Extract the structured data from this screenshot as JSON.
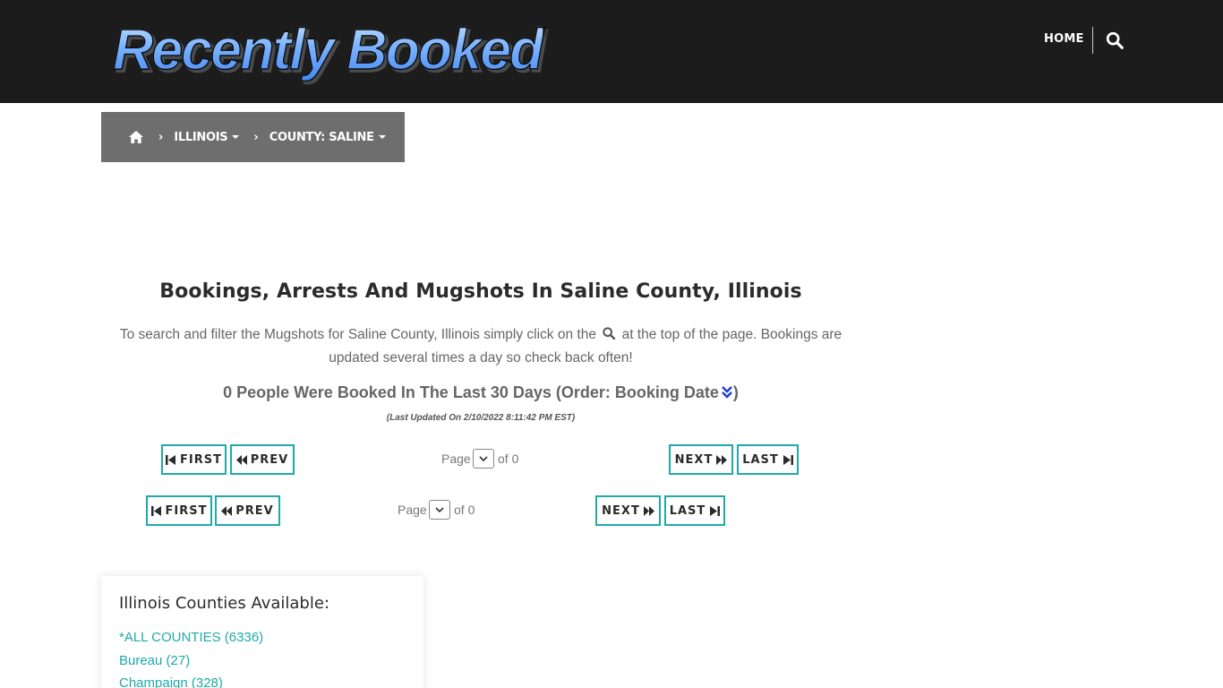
{
  "header": {
    "logo_text": "Recently Booked",
    "nav_home": "HOME",
    "search_icon": "search-icon"
  },
  "breadcrumb": {
    "home_icon": "home-icon",
    "items": [
      {
        "label": "ILLINOIS"
      },
      {
        "label": "COUNTY: SALINE"
      }
    ]
  },
  "main": {
    "headline": "Bookings, Arrests And Mugshots In Saline County, Illinois",
    "intro_before": "To search and filter the Mugshots for Saline County, Illinois simply click on the",
    "intro_after": "at the top of the page. Bookings are updated several times a day so check back often!",
    "count_text": "0 People Were Booked In The Last 30 Days (Order: Booking Date",
    "count_close": ")",
    "last_updated": "(Last Updated On 2/10/2022 8:11:42 PM EST)"
  },
  "pager": {
    "first": "FIRST",
    "prev": "PREV",
    "next": "NEXT",
    "last": "LAST",
    "page_label": "Page",
    "of_label": "of 0"
  },
  "counties": {
    "title": "Illinois Counties Available:",
    "items": [
      {
        "label": "*ALL COUNTIES (6336)"
      },
      {
        "label": "Bureau (27)"
      },
      {
        "label": "Champaign (328)"
      }
    ]
  },
  "colors": {
    "header_bg": "#1c1c1c",
    "breadcrumb_bg": "#6e6e6e",
    "accent_teal": "#1fa9a9",
    "order_icon_blue": "#1a3fd6"
  }
}
